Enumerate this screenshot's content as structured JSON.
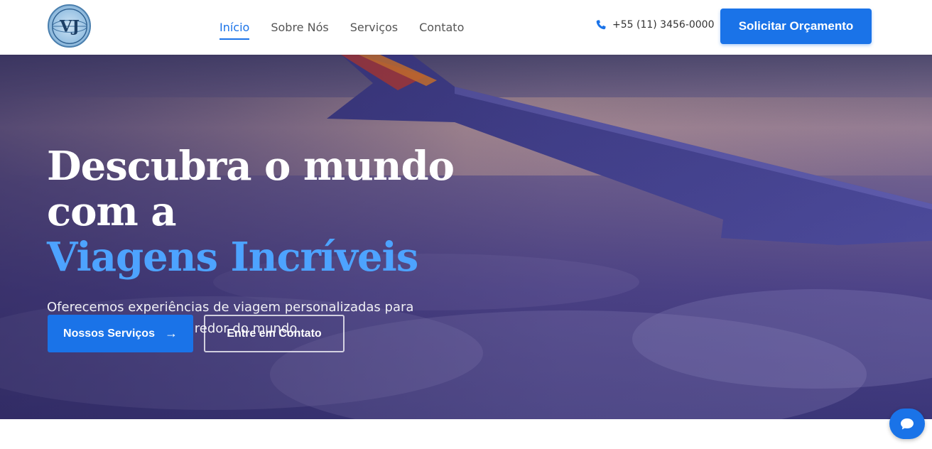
{
  "header": {
    "logo_alt": "VJ",
    "nav": [
      {
        "label": "Início",
        "active": true
      },
      {
        "label": "Sobre Nós",
        "active": false
      },
      {
        "label": "Serviços",
        "active": false
      },
      {
        "label": "Contato",
        "active": false
      }
    ],
    "phone": "+55 (11) 3456-0000",
    "quote_button": "Solicitar Orçamento"
  },
  "hero": {
    "title_line1": "Descubra o mundo com a",
    "title_line2": "Viagens Incríveis",
    "subtitle": "Oferecemos experiências de viagem personalizadas para destinos exclusivos ao redor do mundo.",
    "primary_button": "Nossos Serviços",
    "secondary_button": "Entre em Contato"
  },
  "colors": {
    "accent": "#1a73e8",
    "title_accent": "#4da3ff"
  },
  "icons": {
    "phone": "phone-icon",
    "arrow": "arrow-right-icon",
    "chat": "chat-icon"
  }
}
